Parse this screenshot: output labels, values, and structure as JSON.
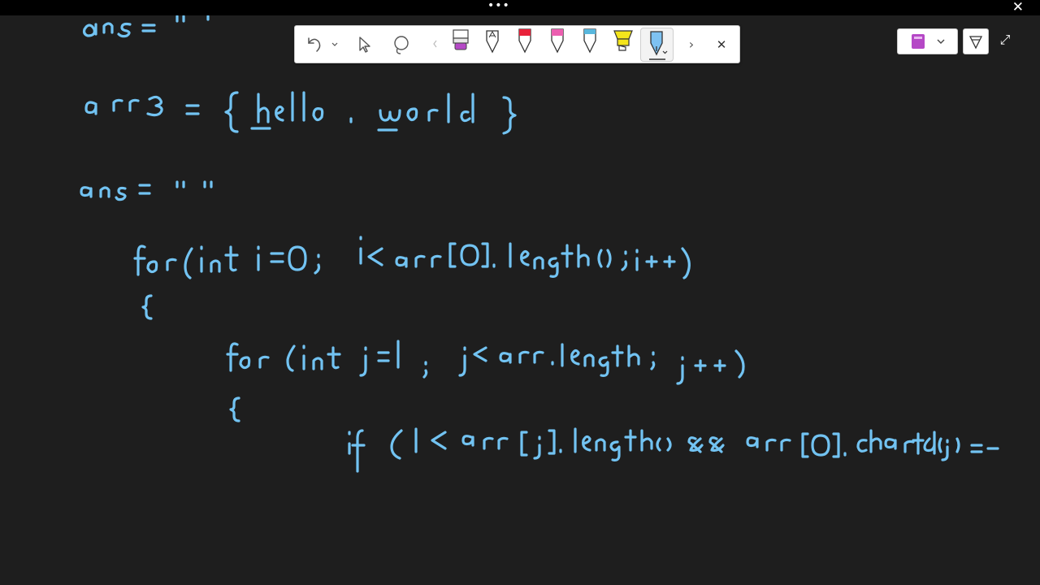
{
  "window": {
    "menu_glyph": "•••",
    "close_glyph": "✕"
  },
  "toolbar": {
    "tools": [
      {
        "name": "undo-icon",
        "glyph": "↶"
      },
      {
        "name": "undo-dropdown-icon",
        "glyph": "⌄"
      },
      {
        "name": "select-cursor-icon",
        "glyph": ""
      },
      {
        "name": "lasso-icon",
        "glyph": ""
      },
      {
        "name": "scroll-left-icon",
        "glyph": "‹"
      }
    ],
    "pens": [
      {
        "name": "eraser-purple-pen",
        "color": "#b548c6"
      },
      {
        "name": "outline-pen",
        "color": "#ffffff"
      },
      {
        "name": "red-pen",
        "color": "#e8213a"
      },
      {
        "name": "pink-pen",
        "color": "#ec5fb0"
      },
      {
        "name": "cyan-pen",
        "color": "#58b7dd"
      },
      {
        "name": "yellow-highlighter",
        "color": "#f4e51c"
      },
      {
        "name": "blue-pen-active",
        "color": "#7ec2f2"
      }
    ],
    "next_glyph": "›",
    "close_glyph": "✕"
  },
  "right": {
    "notebook_color": "#b548c6",
    "expand_glyph": "⤢"
  },
  "ink_color": "#72c3f2"
}
